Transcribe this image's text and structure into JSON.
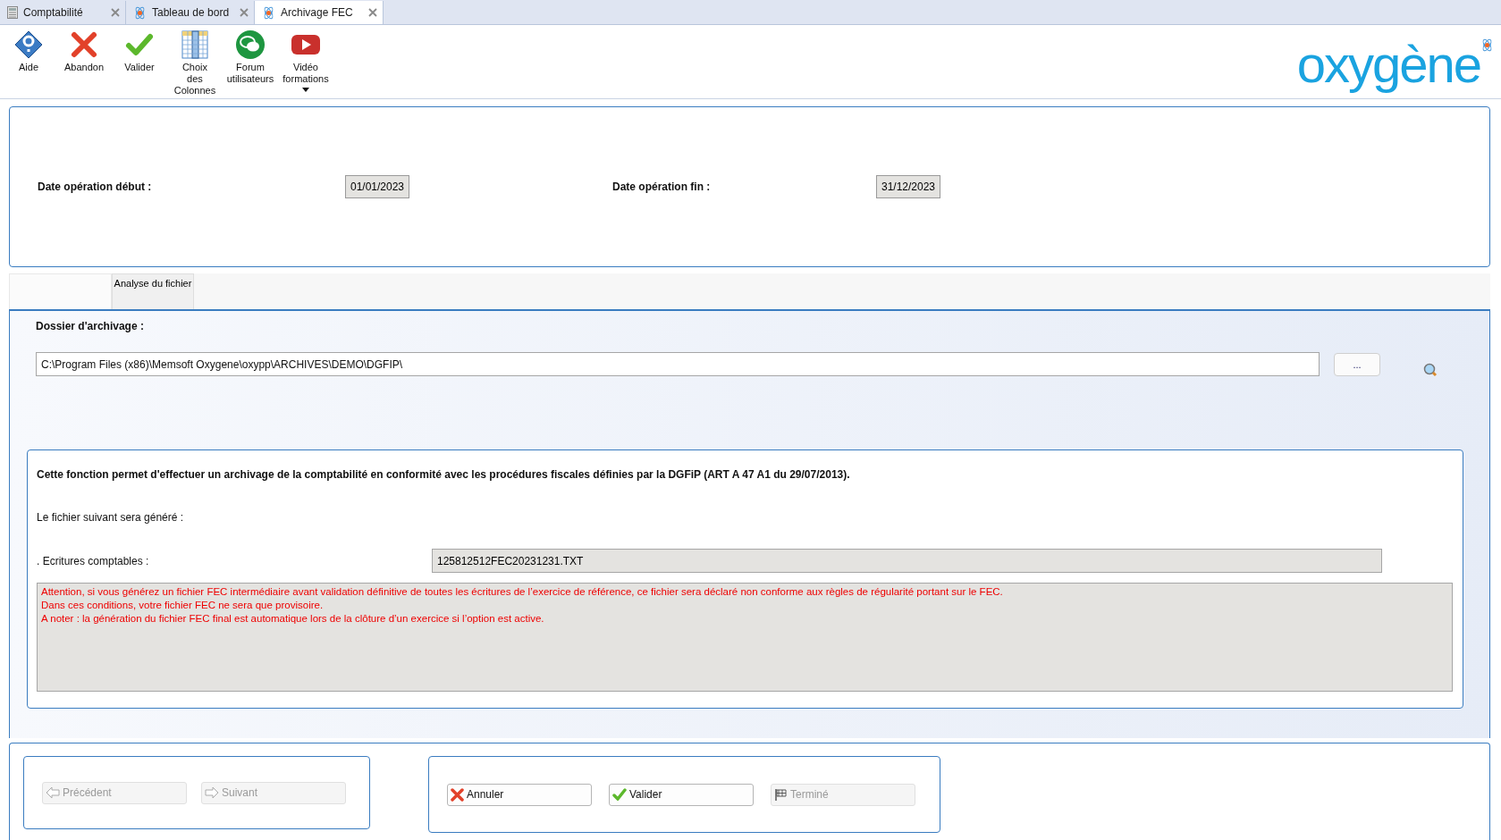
{
  "doc_tabs": [
    {
      "label": "Comptabilité",
      "kind": "calc",
      "selected": false
    },
    {
      "label": "Tableau de bord",
      "kind": "atom",
      "selected": false
    },
    {
      "label": "Archivage FEC",
      "kind": "atom",
      "selected": true
    }
  ],
  "toolbar": [
    {
      "label": "Aide",
      "kind": "help"
    },
    {
      "label": "Abandon",
      "kind": "cancel"
    },
    {
      "label": "Valider",
      "kind": "check"
    },
    {
      "label": "Choix\ndes\nColonnes",
      "kind": "columns"
    },
    {
      "label": "Forum\nutilisateurs",
      "kind": "forum"
    },
    {
      "label": "Vidéo\nformations",
      "kind": "video",
      "has_menu": true
    }
  ],
  "logo": {
    "text": "oxygène"
  },
  "dates": [
    {
      "label": "Date opération début :",
      "value": "01/01/2023"
    },
    {
      "label": "Date opération fin :",
      "value": "31/12/2023"
    }
  ],
  "section_tabs": [
    {
      "label": "Analyse du fichier",
      "selected": false
    }
  ],
  "archive_folder": {
    "label": "Dossier d'archivage :",
    "value": "C:\\Program Files (x86)\\Memsoft Oxygene\\oxypp\\ARCHIVES\\DEMO\\DGFIP\\",
    "browse": "..."
  },
  "info": {
    "intro": "Cette fonction permet d'effectuer un archivage de la comptabilité en conformité avec les procédures fiscales définies par la DGFiP (ART A 47 A1 du 29/07/2013).",
    "generated_label": "Le fichier suivant sera généré :",
    "file_label": ". Ecritures comptables :",
    "file_value": "125812512FEC20231231.TXT",
    "warning": [
      "Attention, si vous générez un fichier FEC intermédiaire avant validation définitive de toutes les écritures de l’exercice de référence, ce fichier sera déclaré non conforme aux règles de régularité portant sur le FEC.",
      "Dans ces conditions, votre fichier FEC ne sera que provisoire.",
      "A noter : la génération du fichier FEC final est automatique lors de la clôture d’un exercice si l’option est active."
    ]
  },
  "nav_buttons": [
    {
      "label": "Précédent",
      "kind": "previous",
      "disabled": true
    },
    {
      "label": "Suivant",
      "kind": "next",
      "disabled": true
    }
  ],
  "action_buttons": [
    {
      "label": "Annuler",
      "kind": "cancel",
      "disabled": false
    },
    {
      "label": "Valider",
      "kind": "check",
      "disabled": false
    },
    {
      "label": "Terminé",
      "kind": "finish",
      "disabled": true
    }
  ]
}
